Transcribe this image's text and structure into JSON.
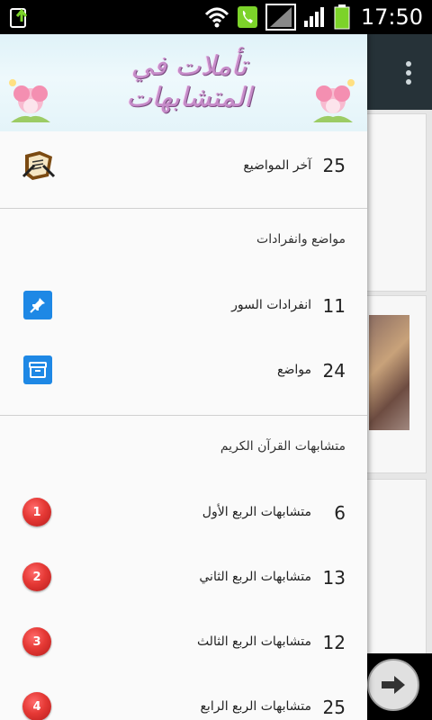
{
  "status_bar": {
    "time": "17:50",
    "icons": [
      "upload-notification-icon",
      "wifi-icon",
      "phone-icon",
      "signal-icon",
      "signal-bars-icon",
      "battery-icon"
    ]
  },
  "drawer": {
    "banner_title": "تأملات في المتشابهات",
    "latest": {
      "count": "25",
      "label": "آخر المواضيع"
    },
    "sections": [
      {
        "title": "مواضع وانفرادات",
        "items": [
          {
            "count": "11",
            "label": "انفرادات السور",
            "icon": "pin-icon"
          },
          {
            "count": "24",
            "label": "مواضع",
            "icon": "archive-icon"
          }
        ]
      },
      {
        "title": "متشابهات القرآن الكريم",
        "items": [
          {
            "count": "6",
            "label": "متشابهات الربع الأول",
            "badge": "1"
          },
          {
            "count": "13",
            "label": "متشابهات الربع الثاني",
            "badge": "2"
          },
          {
            "count": "12",
            "label": "متشابهات الربع الثالث",
            "badge": "3"
          },
          {
            "count": "25",
            "label": "متشابهات الربع الرابع",
            "badge": "4"
          }
        ]
      }
    ]
  },
  "colors": {
    "accent_blue": "#1e88e5",
    "badge_red": "#e53935",
    "toolbar": "#263238"
  }
}
